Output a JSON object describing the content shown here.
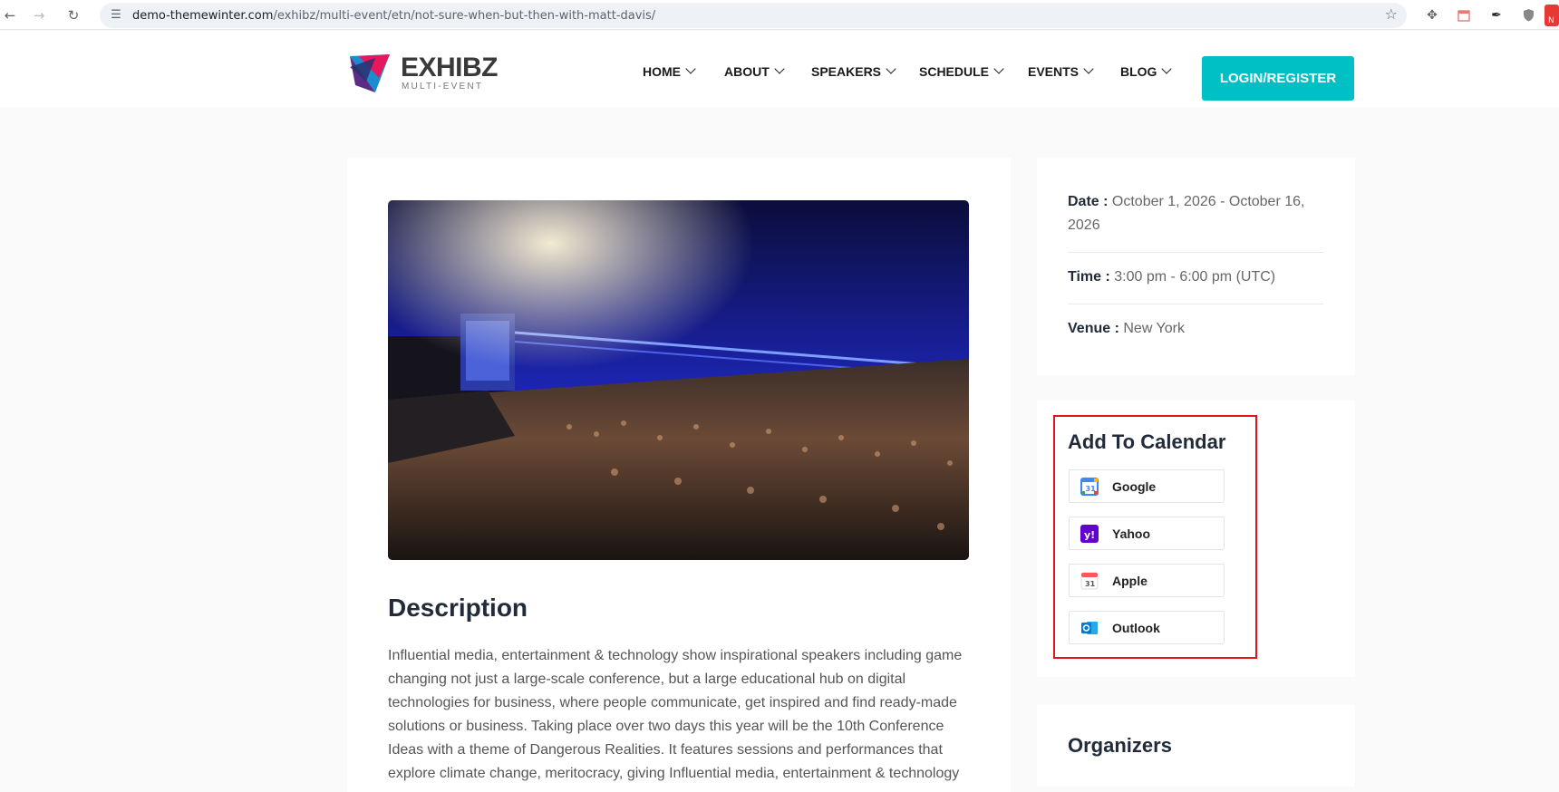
{
  "browser": {
    "url": "demo-themewinter.com/exhibz/multi-event/etn/not-sure-when-but-then-with-matt-davis/",
    "url_host": "demo-themewinter.com",
    "url_path": "/exhibz/multi-event/etn/not-sure-when-but-then-with-matt-davis/"
  },
  "brand": {
    "name": "EXHIBZ",
    "tagline": "MULTI-EVENT",
    "accent": "#00c0c6"
  },
  "nav": {
    "items": [
      {
        "label": "HOME"
      },
      {
        "label": "ABOUT"
      },
      {
        "label": "SPEAKERS"
      },
      {
        "label": "SCHEDULE"
      },
      {
        "label": "EVENTS"
      },
      {
        "label": "BLOG"
      }
    ],
    "login_label": "LOGIN/REGISTER"
  },
  "event": {
    "description_title": "Description",
    "description": "Influential media, entertainment & technology show inspirational speakers including game changing not just a large-scale conference, but a large educational hub on digital technologies for business, where people communicate, get inspired and find ready-made solutions or business. Taking place over two days this year will be the 10th Conference Ideas with a theme of Dangerous Realities. It features sessions and performances that explore climate change, meritocracy, giving Influential media, entertainment & technology"
  },
  "details": {
    "date_label": "Date :",
    "date_value": "October 1, 2026 - October 16, 2026",
    "time_label": "Time :",
    "time_value": "3:00 pm - 6:00 pm (UTC)",
    "venue_label": "Venue :",
    "venue_value": "New York"
  },
  "calendar": {
    "title": "Add To Calendar",
    "options": [
      {
        "label": "Google",
        "icon": "google-calendar-icon"
      },
      {
        "label": "Yahoo",
        "icon": "yahoo-icon"
      },
      {
        "label": "Apple",
        "icon": "apple-calendar-icon"
      },
      {
        "label": "Outlook",
        "icon": "outlook-icon"
      }
    ],
    "highlight_color": "#e0141e"
  },
  "organizers": {
    "title": "Organizers"
  }
}
